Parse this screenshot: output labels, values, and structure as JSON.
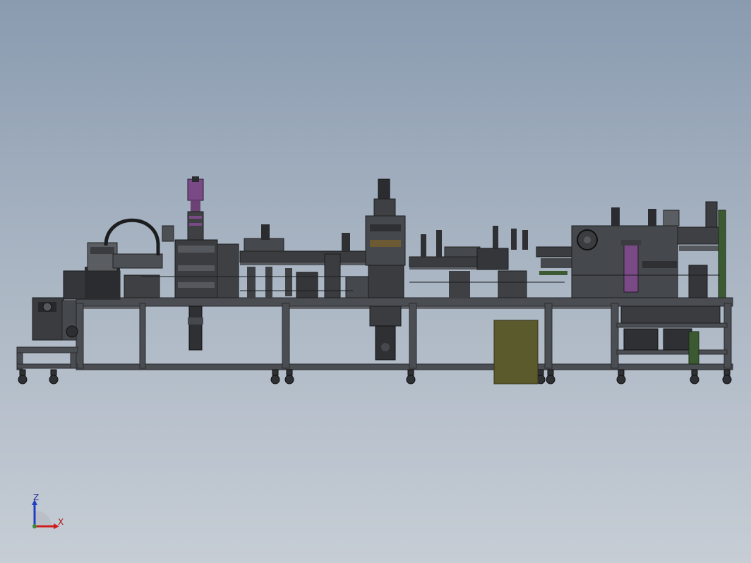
{
  "axes": {
    "x_label": "X",
    "z_label": "Z"
  },
  "colors": {
    "background_top": "#8a9bb0",
    "background_bottom": "#c6cdd5",
    "frame": "#4a4d52",
    "machine_dark": "#2e3033",
    "accent_purple": "#7a4a86",
    "panel_olive": "#5b5a2c",
    "accent_green": "#3b5a32",
    "axis_x": "#d01c1c",
    "axis_z": "#1f3fbf"
  },
  "icons": {
    "triad": "coordinate-triad-icon"
  }
}
